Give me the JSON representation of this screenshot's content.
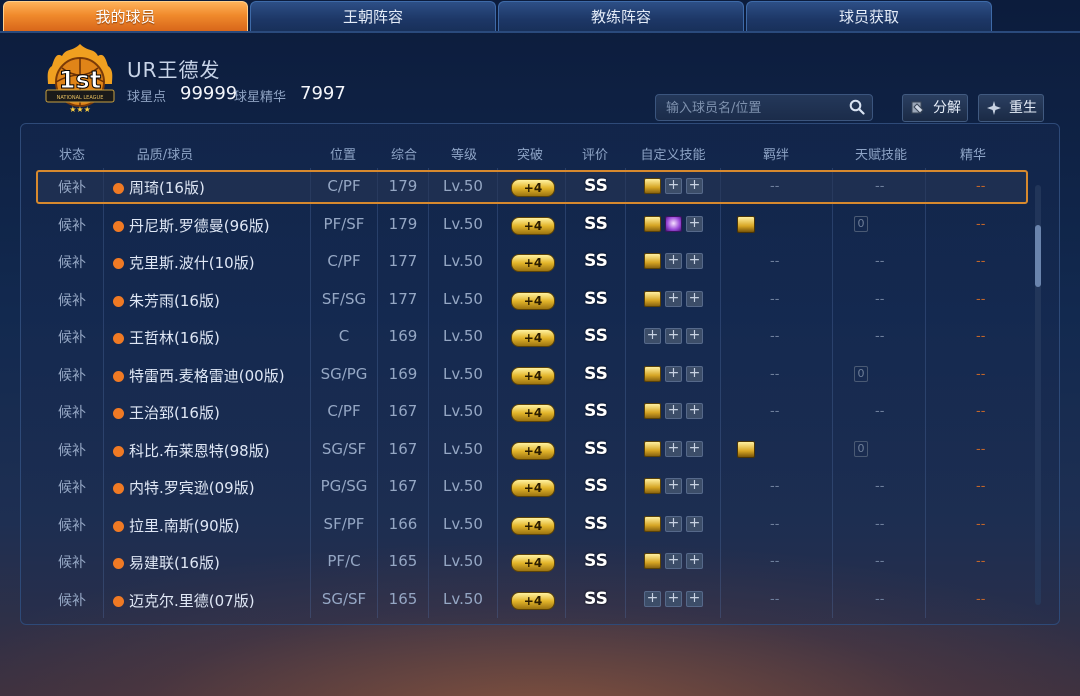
{
  "tabs": [
    {
      "label": "我的球员",
      "active": true
    },
    {
      "label": "王朝阵容",
      "active": false
    },
    {
      "label": "教练阵容",
      "active": false
    },
    {
      "label": "球员获取",
      "active": false
    }
  ],
  "header": {
    "badge_rank": "1st",
    "badge_text": "NATIONAL LEAGUE",
    "name": "UR王德发",
    "stat1_label": "球星点",
    "stat1_value": "99999",
    "stat2_label": "球星精华",
    "stat2_value": "7997"
  },
  "search": {
    "placeholder": "输入球员名/位置",
    "icon": "search-icon"
  },
  "buttons": {
    "decompose": "分解",
    "rebirth": "重生"
  },
  "columns": [
    "状态",
    "品质/球员",
    "位置",
    "综合",
    "等级",
    "突破",
    "评价",
    "自定义技能",
    "羁绊",
    "天赋技能",
    "精华"
  ],
  "colors": {
    "tab_active": "#f08a2c",
    "selected_border": "#d7892e",
    "quality_dot": "#f07a24"
  },
  "rows": [
    {
      "status": "候补",
      "name": "周琦(16版)",
      "pos": "C/PF",
      "ovr": "179",
      "level": "Lv.50",
      "breakthrough": "+4",
      "grade": "SS",
      "skills": [
        "gold",
        "empty",
        "empty"
      ],
      "bond": "--",
      "talent": "--",
      "essence": "--",
      "selected": true
    },
    {
      "status": "候补",
      "name": "丹尼斯.罗德曼(96版)",
      "pos": "PF/SF",
      "ovr": "179",
      "level": "Lv.50",
      "breakthrough": "+4",
      "grade": "SS",
      "skills": [
        "gold",
        "purple",
        "empty"
      ],
      "bond": "icon",
      "talent": "0",
      "essence": "--",
      "selected": false
    },
    {
      "status": "候补",
      "name": "克里斯.波什(10版)",
      "pos": "C/PF",
      "ovr": "177",
      "level": "Lv.50",
      "breakthrough": "+4",
      "grade": "SS",
      "skills": [
        "gold",
        "empty",
        "empty"
      ],
      "bond": "--",
      "talent": "--",
      "essence": "--",
      "selected": false
    },
    {
      "status": "候补",
      "name": "朱芳雨(16版)",
      "pos": "SF/SG",
      "ovr": "177",
      "level": "Lv.50",
      "breakthrough": "+4",
      "grade": "SS",
      "skills": [
        "gold",
        "empty",
        "empty"
      ],
      "bond": "--",
      "talent": "--",
      "essence": "--",
      "selected": false
    },
    {
      "status": "候补",
      "name": "王哲林(16版)",
      "pos": "C",
      "ovr": "169",
      "level": "Lv.50",
      "breakthrough": "+4",
      "grade": "SS",
      "skills": [
        "empty",
        "empty",
        "empty"
      ],
      "bond": "--",
      "talent": "--",
      "essence": "--",
      "selected": false
    },
    {
      "status": "候补",
      "name": "特雷西.麦格雷迪(00版)",
      "pos": "SG/PG",
      "ovr": "169",
      "level": "Lv.50",
      "breakthrough": "+4",
      "grade": "SS",
      "skills": [
        "gold",
        "empty",
        "empty"
      ],
      "bond": "--",
      "talent": "0",
      "essence": "--",
      "selected": false
    },
    {
      "status": "候补",
      "name": "王治郅(16版)",
      "pos": "C/PF",
      "ovr": "167",
      "level": "Lv.50",
      "breakthrough": "+4",
      "grade": "SS",
      "skills": [
        "gold",
        "empty",
        "empty"
      ],
      "bond": "--",
      "talent": "--",
      "essence": "--",
      "selected": false
    },
    {
      "status": "候补",
      "name": "科比.布莱恩特(98版)",
      "pos": "SG/SF",
      "ovr": "167",
      "level": "Lv.50",
      "breakthrough": "+4",
      "grade": "SS",
      "skills": [
        "gold",
        "empty",
        "empty"
      ],
      "bond": "icon",
      "talent": "0",
      "essence": "--",
      "selected": false
    },
    {
      "status": "候补",
      "name": "内特.罗宾逊(09版)",
      "pos": "PG/SG",
      "ovr": "167",
      "level": "Lv.50",
      "breakthrough": "+4",
      "grade": "SS",
      "skills": [
        "gold",
        "empty",
        "empty"
      ],
      "bond": "--",
      "talent": "--",
      "essence": "--",
      "selected": false
    },
    {
      "status": "候补",
      "name": "拉里.南斯(90版)",
      "pos": "SF/PF",
      "ovr": "166",
      "level": "Lv.50",
      "breakthrough": "+4",
      "grade": "SS",
      "skills": [
        "gold",
        "empty",
        "empty"
      ],
      "bond": "--",
      "talent": "--",
      "essence": "--",
      "selected": false
    },
    {
      "status": "候补",
      "name": "易建联(16版)",
      "pos": "PF/C",
      "ovr": "165",
      "level": "Lv.50",
      "breakthrough": "+4",
      "grade": "SS",
      "skills": [
        "gold",
        "empty",
        "empty"
      ],
      "bond": "--",
      "talent": "--",
      "essence": "--",
      "selected": false
    },
    {
      "status": "候补",
      "name": "迈克尔.里德(07版)",
      "pos": "SG/SF",
      "ovr": "165",
      "level": "Lv.50",
      "breakthrough": "+4",
      "grade": "SS",
      "skills": [
        "empty",
        "empty",
        "empty"
      ],
      "bond": "--",
      "talent": "--",
      "essence": "--",
      "selected": false
    }
  ]
}
